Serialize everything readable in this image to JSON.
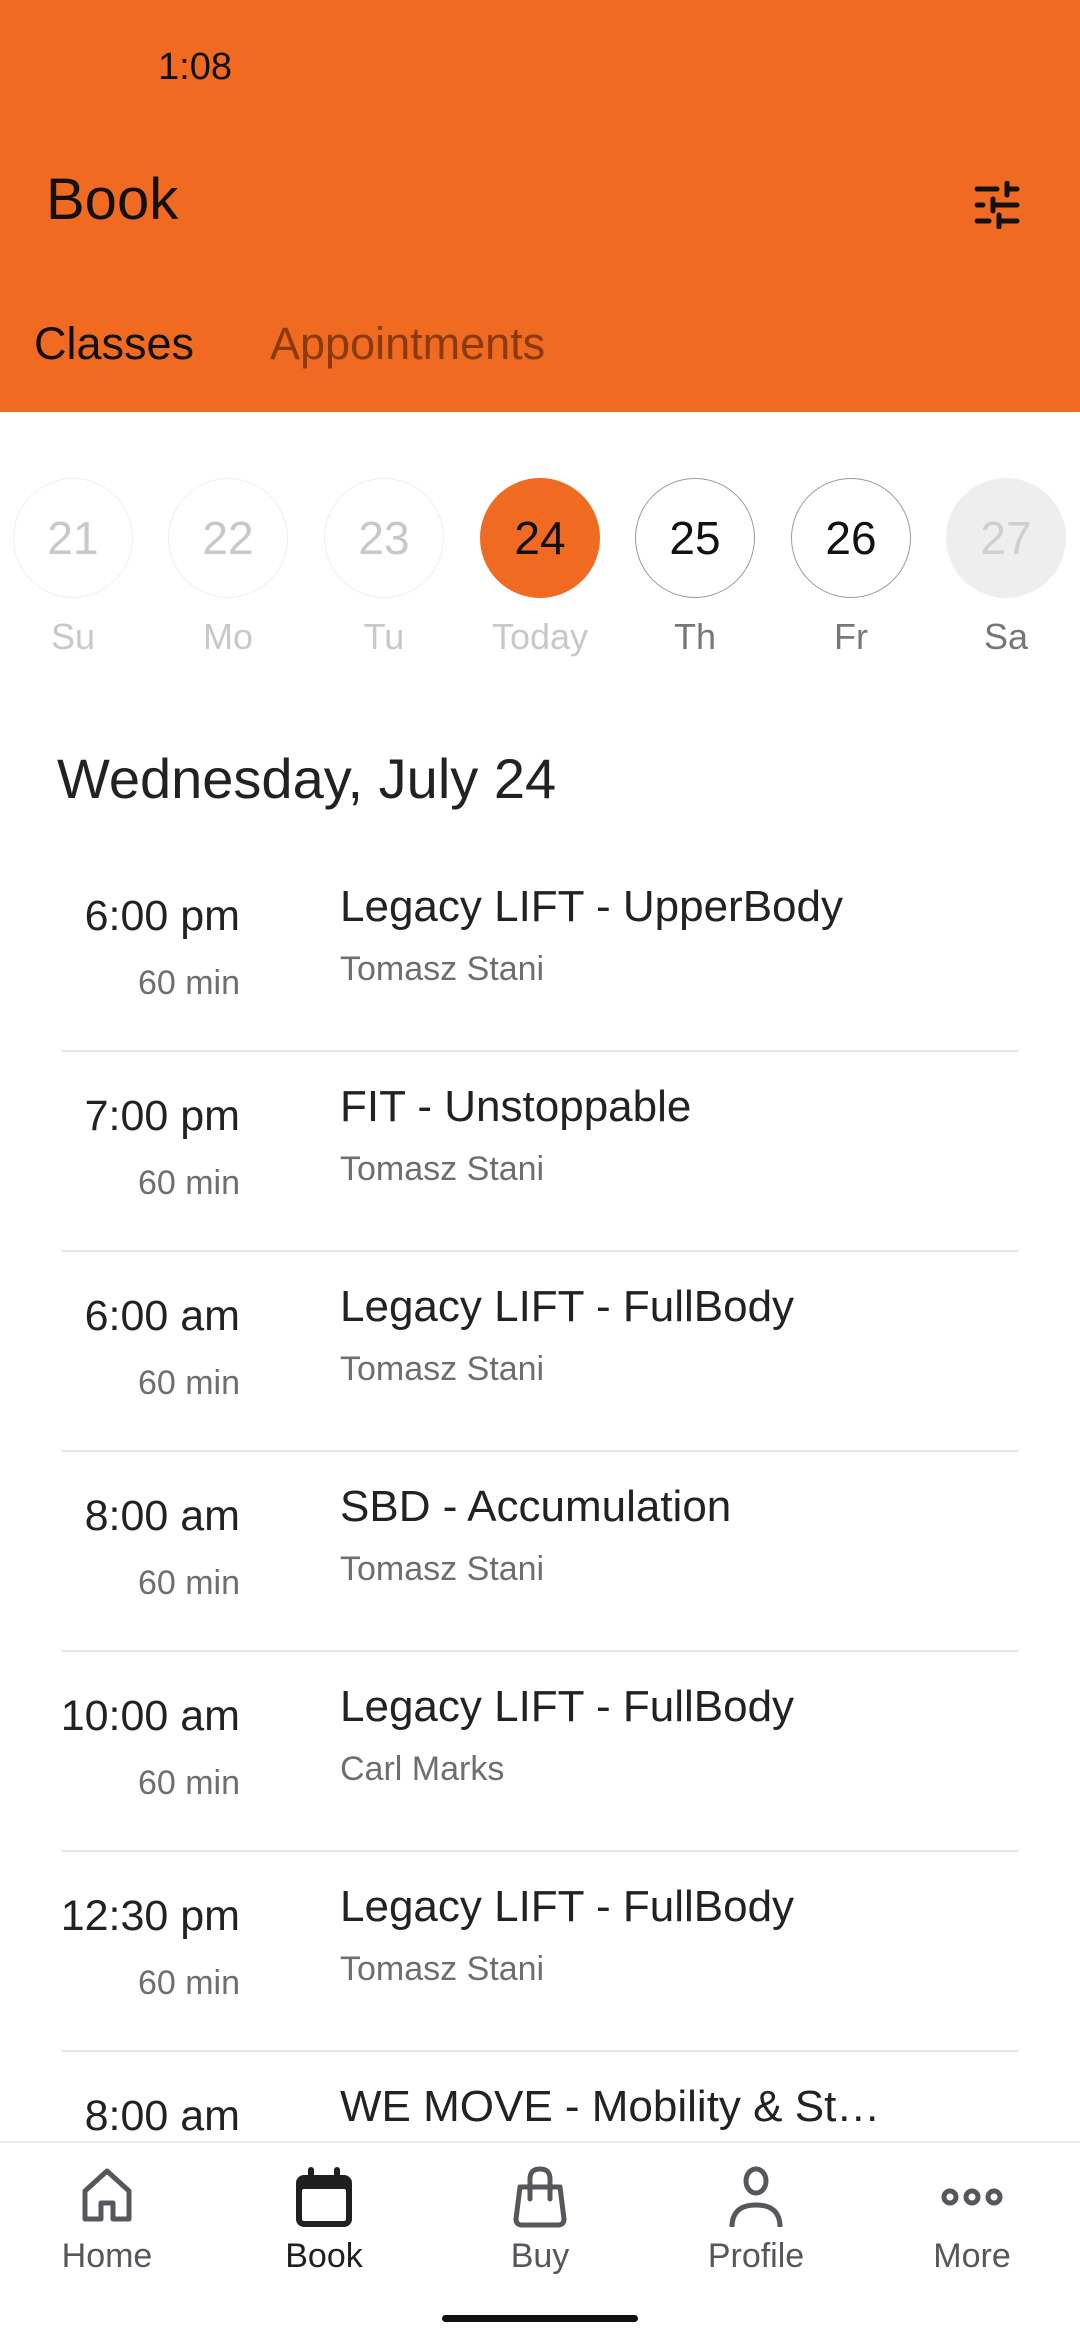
{
  "status_bar": {
    "time": "1:08"
  },
  "header": {
    "title": "Book",
    "filter_icon": "tune-sliders-icon",
    "brand_color": "#F06A22"
  },
  "tabs": [
    {
      "label": "Classes",
      "active": true
    },
    {
      "label": "Appointments",
      "active": false
    }
  ],
  "date_strip": [
    {
      "day": "21",
      "label": "Su",
      "state": "past"
    },
    {
      "day": "22",
      "label": "Mo",
      "state": "past"
    },
    {
      "day": "23",
      "label": "Tu",
      "state": "past"
    },
    {
      "day": "24",
      "label": "Today",
      "state": "selected"
    },
    {
      "day": "25",
      "label": "Th",
      "state": "available"
    },
    {
      "day": "26",
      "label": "Fr",
      "state": "available"
    },
    {
      "day": "27",
      "label": "Sa",
      "state": "unavailable"
    }
  ],
  "schedule": {
    "heading": "Wednesday, July 24",
    "classes": [
      {
        "time": "6:00 pm",
        "duration": "60 min",
        "title": "Legacy LIFT - UpperBody",
        "instructor": "Tomasz Stani"
      },
      {
        "time": "7:00 pm",
        "duration": "60 min",
        "title": "FIT - Unstoppable",
        "instructor": "Tomasz Stani"
      },
      {
        "time": "6:00 am",
        "duration": "60 min",
        "title": "Legacy LIFT - FullBody",
        "instructor": "Tomasz Stani"
      },
      {
        "time": "8:00 am",
        "duration": "60 min",
        "title": "SBD - Accumulation",
        "instructor": "Tomasz Stani"
      },
      {
        "time": "10:00 am",
        "duration": "60 min",
        "title": "Legacy LIFT - FullBody",
        "instructor": "Carl Marks"
      },
      {
        "time": "12:30 pm",
        "duration": "60 min",
        "title": "Legacy LIFT - FullBody",
        "instructor": "Tomasz Stani"
      },
      {
        "time": "8:00 am",
        "duration": "",
        "title": "WE MOVE - Mobility & St…",
        "instructor": ""
      }
    ]
  },
  "bottom_nav": [
    {
      "label": "Home",
      "icon": "home-icon",
      "active": false
    },
    {
      "label": "Book",
      "icon": "calendar-icon",
      "active": true
    },
    {
      "label": "Buy",
      "icon": "shopping-bag-icon",
      "active": false
    },
    {
      "label": "Profile",
      "icon": "person-icon",
      "active": false
    },
    {
      "label": "More",
      "icon": "more-dots-icon",
      "active": false
    }
  ]
}
